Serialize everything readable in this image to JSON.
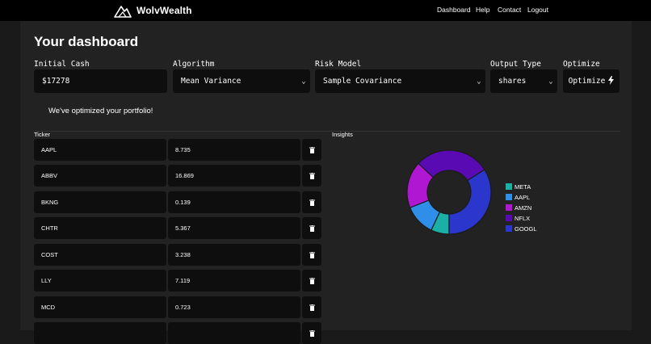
{
  "navbar": {
    "brand": "WolvWealth",
    "links": [
      "Dashboard",
      "Help",
      "Contact",
      "Logout"
    ]
  },
  "page": {
    "title": "Your dashboard"
  },
  "form": {
    "initial_cash": {
      "label": "Initial Cash",
      "value": "$17278"
    },
    "algorithm": {
      "label": "Algorithm",
      "value": "Mean Variance"
    },
    "risk_model": {
      "label": "Risk Model",
      "value": "Sample Covariance"
    },
    "output_type": {
      "label": "Output Type",
      "value": "shares"
    },
    "optimize": {
      "label": "Optimize",
      "button": "Optimize"
    }
  },
  "message": "We've optimized your portfolio!",
  "ticker_section": {
    "header": "Ticker",
    "rows": [
      {
        "ticker": "AAPL",
        "value": "8.735"
      },
      {
        "ticker": "ABBV",
        "value": "16.869"
      },
      {
        "ticker": "BKNG",
        "value": "0.139"
      },
      {
        "ticker": "CHTR",
        "value": "5.367"
      },
      {
        "ticker": "COST",
        "value": "3.238"
      },
      {
        "ticker": "LLY",
        "value": "7.119"
      },
      {
        "ticker": "MCD",
        "value": "0.723"
      },
      {
        "ticker": "",
        "value": ""
      }
    ]
  },
  "insights": {
    "header": "Insights"
  },
  "chart_data": {
    "type": "pie",
    "donut": true,
    "legend_position": "right",
    "slices": [
      {
        "label": "META",
        "value": 7,
        "color": "#1ab0a6"
      },
      {
        "label": "AAPL",
        "value": 12,
        "color": "#2f8ee8"
      },
      {
        "label": "AMZN",
        "value": 18,
        "color": "#b017d2"
      },
      {
        "label": "NFLX",
        "value": 29,
        "color": "#5a0ab3"
      },
      {
        "label": "GOOGL",
        "value": 34,
        "color": "#2a36cc"
      }
    ],
    "slice_order_clockwise_from_bottom": [
      "META",
      "AAPL",
      "AMZN",
      "NFLX",
      "GOOGL"
    ]
  },
  "colors": {
    "navbar": "#000000",
    "background": "#1a1a1a",
    "panel": "#222222",
    "field": "#0e0e0e"
  },
  "icons": {
    "brand": "mountain-logo-icon",
    "select": "chevron-down-icon",
    "optimize": "lightning-bolt-icon",
    "delete": "trash-icon"
  }
}
